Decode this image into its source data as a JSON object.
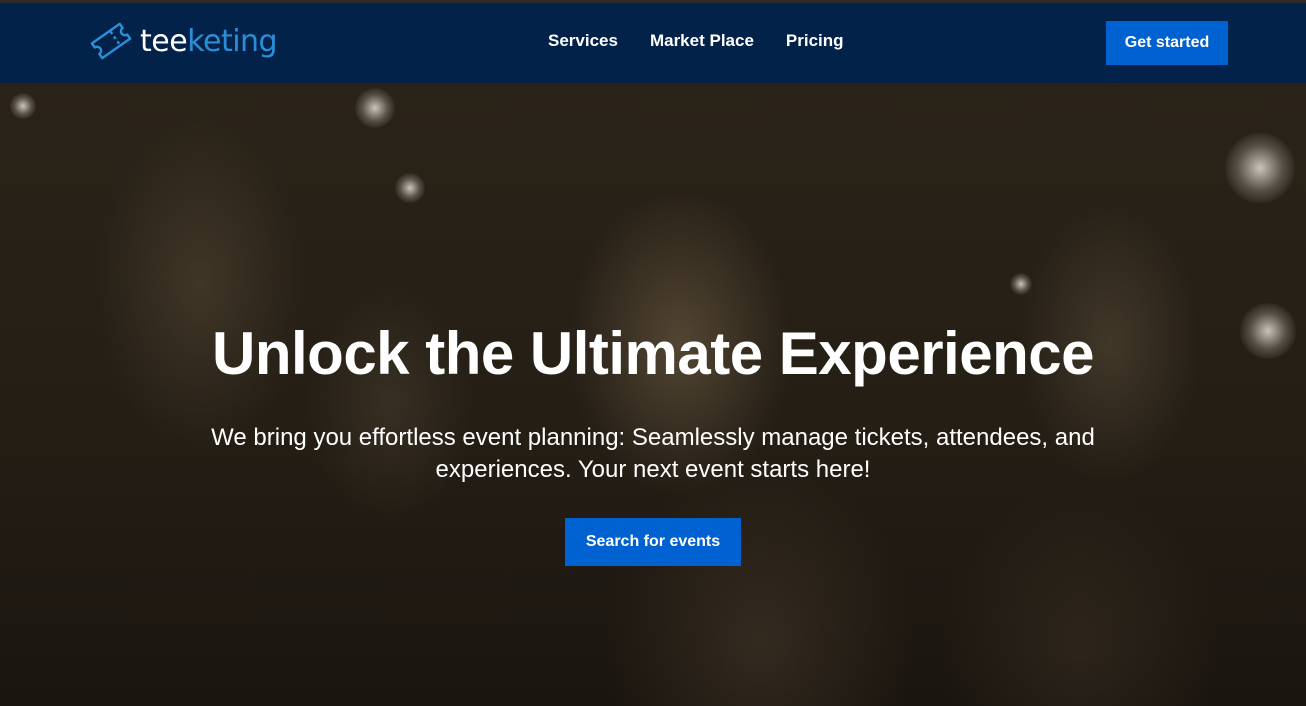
{
  "brand": {
    "name_part1": "tee",
    "name_part2": "keting",
    "logo_icon": "ticket-icon",
    "accent_color": "#2a8fd8"
  },
  "nav": {
    "links": [
      {
        "label": "Services"
      },
      {
        "label": "Market Place"
      },
      {
        "label": "Pricing"
      }
    ],
    "cta_label": "Get started"
  },
  "hero": {
    "title": "Unlock the Ultimate Experience",
    "subtitle": "We bring you effortless event planning: Seamlessly manage tickets, attendees, and experiences. Your next event starts here!",
    "cta_label": "Search for events"
  },
  "colors": {
    "navbar_bg": "#03224a",
    "button_bg": "#0062d1",
    "text": "#ffffff"
  }
}
